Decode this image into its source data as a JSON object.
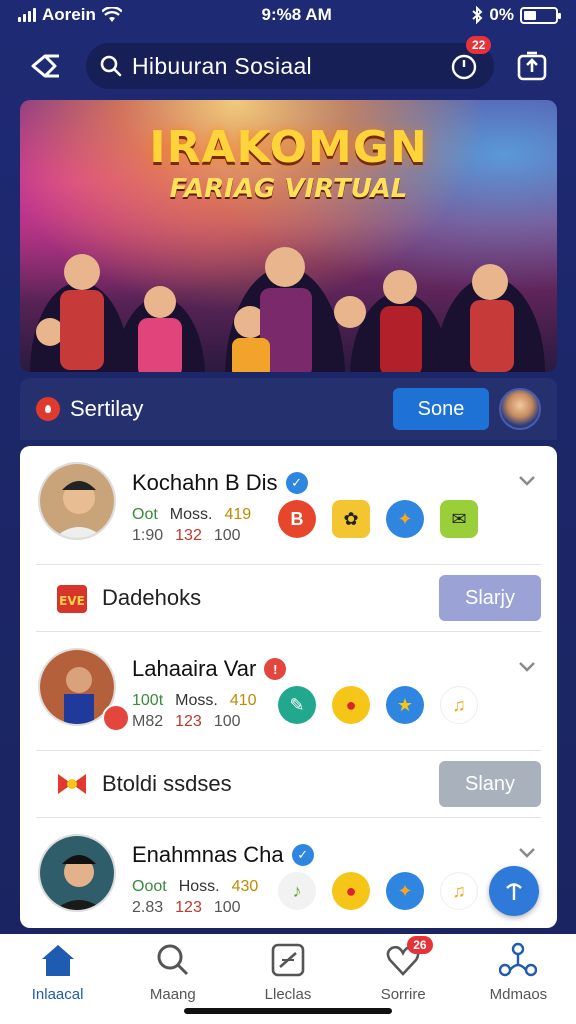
{
  "status": {
    "carrier": "Aorein",
    "time": "9:%8 AM",
    "battery": "0%",
    "battery_level": 0.4
  },
  "header": {
    "search_text": "Hibuuran Sosiaal",
    "timer_badge": "22"
  },
  "hero": {
    "title": "IRAKOMGN",
    "subtitle": "FARIAG VIRTUAL"
  },
  "sort": {
    "label": "Sertilay",
    "button": "Sone"
  },
  "users": [
    {
      "name": "Kochahn B Dis",
      "mark": "verified",
      "line1": [
        "Oot",
        "Moss.",
        "419"
      ],
      "line2": [
        "1:90",
        "132",
        "100"
      ]
    },
    {
      "name": "Lahaaira Var",
      "mark": "red",
      "line1": [
        "100t",
        "Moss.",
        "410"
      ],
      "line2": [
        "M82",
        "123",
        "100"
      ]
    },
    {
      "name": "Enahmnas Cha",
      "mark": "verified",
      "line1": [
        "Ooot",
        "Hoss.",
        "430"
      ],
      "line2": [
        "2.83",
        "123",
        "100"
      ]
    }
  ],
  "actions": [
    {
      "label": "Dadehoks",
      "button": "Slarjy",
      "button_color": "#9aa2d6"
    },
    {
      "label": "Btoldi ssdses",
      "button": "Slany",
      "button_color": "#a9b1bd"
    }
  ],
  "tabs": [
    {
      "label": "Inlaacal",
      "active": true
    },
    {
      "label": "Maang",
      "active": false
    },
    {
      "label": "Lleclas",
      "active": false
    },
    {
      "label": "Sorrire",
      "active": false,
      "badge": "26"
    },
    {
      "label": "Mdmaos",
      "active": false
    }
  ],
  "colors": {
    "accent": "#1e72d6",
    "verified": "#2f86e0",
    "badge": "#e8323a",
    "background": "#1e2a74"
  }
}
